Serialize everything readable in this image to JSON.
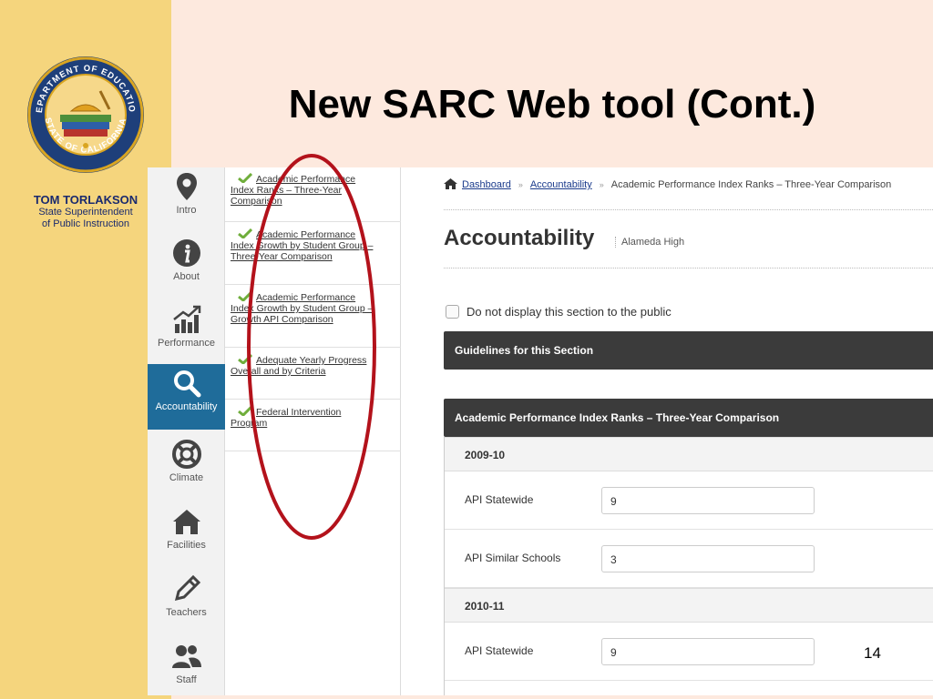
{
  "slide": {
    "title": "New SARC Web tool (Cont.)",
    "presenter_name": "TOM TORLAKSON",
    "presenter_role_line1": "State Superintendent",
    "presenter_role_line2": "of Public Instruction",
    "slide_number": "14",
    "seal_text_top": "DEPARTMENT OF EDUCATION",
    "seal_text_bottom": "STATE OF CALIFORNIA",
    "colors": {
      "left_band": "#f5d57d",
      "background": "#fde9de",
      "title_text": "#000000",
      "presenter_text": "#1a2a6e",
      "highlight_oval": "#b3121b"
    }
  },
  "app": {
    "nav": [
      {
        "label": "Intro",
        "icon": "map-pin-icon",
        "active": false
      },
      {
        "label": "About",
        "icon": "info-icon",
        "active": false
      },
      {
        "label": "Performance",
        "icon": "bar-chart-icon",
        "active": false
      },
      {
        "label": "Accountability",
        "icon": "search-icon",
        "active": true
      },
      {
        "label": "Climate",
        "icon": "lifebuoy-icon",
        "active": false
      },
      {
        "label": "Facilities",
        "icon": "home-icon",
        "active": false
      },
      {
        "label": "Teachers",
        "icon": "pencil-icon",
        "active": false
      },
      {
        "label": "Staff",
        "icon": "users-icon",
        "active": false
      }
    ],
    "sections": [
      {
        "lead": "Academic Performance",
        "rest": "Index Ranks – Three-Year Comparison",
        "complete": true
      },
      {
        "lead": "Academic Performance",
        "rest": "Index Growth by Student Group – Three-Year Comparison",
        "complete": true
      },
      {
        "lead": "Academic Performance",
        "rest": "Index Growth by Student Group – Growth API Comparison",
        "complete": true
      },
      {
        "lead": "Adequate Yearly Progress",
        "rest": "Overall and by Criteria",
        "complete": true
      },
      {
        "lead": "Federal Intervention",
        "rest": "Program",
        "complete": true
      }
    ],
    "breadcrumb": {
      "home_icon": "home-icon",
      "items": [
        "Dashboard",
        "Accountability"
      ],
      "current": "Academic Performance Index Ranks – Three-Year Comparison",
      "separator": "»"
    },
    "page_title": "Accountability",
    "school_name": "Alameda High",
    "hide_checkbox_label": "Do not display this section to the public",
    "guidelines_label": "Guidelines for this Section",
    "panel_title": "Academic Performance Index Ranks – Three-Year Comparison",
    "years": [
      {
        "label": "2009-10",
        "fields": [
          {
            "label": "API Statewide",
            "value": "9"
          },
          {
            "label": "API Similar Schools",
            "value": "3"
          }
        ]
      },
      {
        "label": "2010-11",
        "fields": [
          {
            "label": "API Statewide",
            "value": "9"
          }
        ]
      }
    ],
    "colors": {
      "active_nav": "#1f6c9a",
      "dark_bar": "#3b3b3b",
      "link": "#1a3b8c",
      "check_green": "#6fae3b"
    }
  }
}
